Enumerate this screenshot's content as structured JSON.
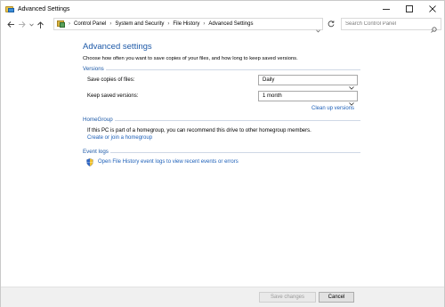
{
  "window": {
    "title": "Advanced Settings",
    "controls": [
      "minimize",
      "maximize",
      "close"
    ]
  },
  "nav": {
    "back_icon": "arrow-left-icon",
    "forward_icon": "arrow-right-icon",
    "up_icon": "arrow-up-icon",
    "breadcrumbs": [
      "Control Panel",
      "System and Security",
      "File History",
      "Advanced Settings"
    ],
    "search_placeholder": "Search Control Panel"
  },
  "main": {
    "title": "Advanced settings",
    "intro": "Choose how often you want to save copies of your files, and how long to keep saved versions.",
    "versions": {
      "heading": "Versions",
      "save_copies_label": "Save copies of files:",
      "save_copies_value": "Daily",
      "keep_versions_label": "Keep saved versions:",
      "keep_versions_value": "1 month",
      "cleanup_link": "Clean up versions"
    },
    "homegroup": {
      "heading": "HomeGroup",
      "text": "If this PC is part of a homegroup, you can recommend this drive to other homegroup members.",
      "link": "Create or join a homegroup"
    },
    "event_logs": {
      "heading": "Event logs",
      "link": "Open File History event logs to view recent events or errors"
    }
  },
  "footer": {
    "save_label": "Save changes",
    "cancel_label": "Cancel"
  },
  "colors": {
    "heading_blue": "#1e5aa8",
    "link_blue": "#1c5fb8"
  }
}
